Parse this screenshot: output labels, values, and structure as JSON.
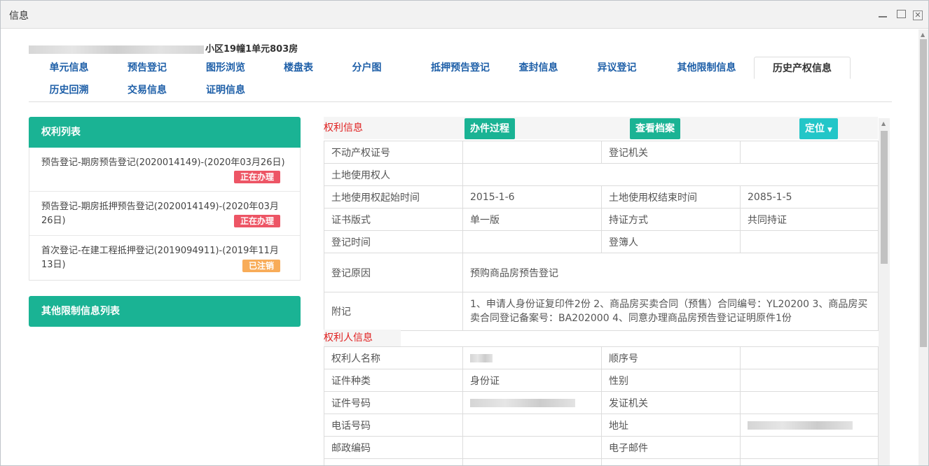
{
  "window": {
    "title": "信息"
  },
  "address": {
    "text": "小区19幢1单元803房"
  },
  "tabs": [
    {
      "label": "单元信息"
    },
    {
      "label": "预告登记"
    },
    {
      "label": "图形浏览"
    },
    {
      "label": "楼盘表"
    },
    {
      "label": "分户图"
    },
    {
      "label": "抵押预告登记"
    },
    {
      "label": "查封信息"
    },
    {
      "label": "异议登记"
    },
    {
      "label": "其他限制信息"
    },
    {
      "label": "历史产权信息"
    },
    {
      "label": "历史回溯"
    },
    {
      "label": "交易信息"
    },
    {
      "label": "证明信息"
    }
  ],
  "left_panel": {
    "rights_title": "权利列表",
    "rights": [
      {
        "text": "预告登记-期房预告登记(2020014149)-(2020年03月26日)",
        "status": "正在办理"
      },
      {
        "text": "预告登记-期房抵押预告登记(2020014149)-(2020年03月26日)",
        "status": "正在办理"
      },
      {
        "text": "首次登记-在建工程抵押登记(2019094911)-(2019年11月13日)",
        "status": "已注销"
      }
    ],
    "other_title": "其他限制信息列表"
  },
  "rights_info": {
    "section_label": "权利信息",
    "btn_process": "办件过程",
    "btn_archive": "查看档案",
    "btn_locate": "定位",
    "rows": {
      "cert_no_label": "不动产权证号",
      "cert_no_value": "",
      "reg_org_label": "登记机关",
      "reg_org_value": "",
      "land_user_label": "土地使用权人",
      "land_user_value": "",
      "land_start_label": "土地使用权起始时间",
      "land_start_value": "2015-1-6",
      "land_end_label": "土地使用权结束时间",
      "land_end_value": "2085-1-5",
      "cert_format_label": "证书版式",
      "cert_format_value": "单一版",
      "hold_mode_label": "持证方式",
      "hold_mode_value": "共同持证",
      "reg_time_label": "登记时间",
      "reg_time_value": "",
      "registrar_label": "登簿人",
      "registrar_value": "",
      "reason_label": "登记原因",
      "reason_value": "预购商品房预告登记",
      "remark_label": "附记",
      "remark_value": "1、申请人身份证复印件2份 2、商品房买卖合同（预售）合同编号：YL20200 3、商品房买卖合同登记备案号：BA202000 4、同意办理商品房预告登记证明原件1份"
    }
  },
  "holder_info": {
    "section_label": "权利人信息",
    "rows": {
      "name_label": "权利人名称",
      "order_label": "顺序号",
      "id_type_label": "证件种类",
      "id_type_value": "身份证",
      "gender_label": "性别",
      "id_no_label": "证件号码",
      "issuer_label": "发证机关",
      "phone_label": "电话号码",
      "address_label": "地址",
      "postcode_label": "邮政编码",
      "email_label": "电子邮件"
    }
  },
  "colors": {
    "accent_green": "#1ab394",
    "accent_cyan": "#23c6c8",
    "badge_red": "#ed5565",
    "badge_orange": "#f8ac59",
    "tab_blue": "#1e5fa8",
    "section_red": "#e02020"
  }
}
